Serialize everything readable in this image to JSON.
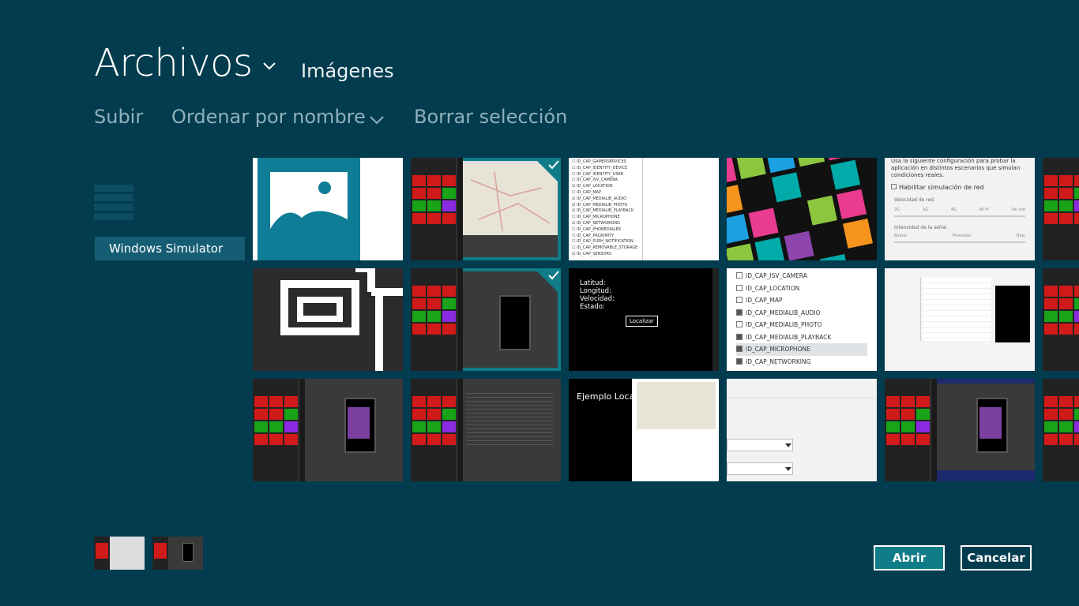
{
  "header": {
    "title": "Archivos",
    "subtitle": "Imágenes"
  },
  "commands": {
    "up": "Subir",
    "sort": "Ordenar por nombre",
    "clear": "Borrar selección"
  },
  "location": "Windows Simulator",
  "tiles": {
    "t14_lines": [
      "Latitud:",
      "Longitud:",
      "Velocidad:",
      "Estado:"
    ],
    "t14_button": "Localizar",
    "t15_caps": [
      "ID_CAP_ISV_CAMERA",
      "ID_CAP_LOCATION",
      "ID_CAP_MAP",
      "ID_CAP_MEDIALIB_AUDIO",
      "ID_CAP_MEDIALIB_PHOTO",
      "ID_CAP_MEDIALIB_PLAYBACK",
      "ID_CAP_MICROPHONE",
      "ID_CAP_NETWORKING"
    ],
    "t05_text1": "Usa la siguiente configuración para probar la aplicación en distintos escenarios que simulan condiciones reales.",
    "t05_check": "Habilitar simulación de red",
    "t05_net_speed": "Velocidad de red",
    "t05_speeds": [
      "2G",
      "3G",
      "4G",
      "Wi-Fi",
      "Sin red"
    ],
    "t05_signal": "Intensidad de la señal",
    "t05_signal_levels": [
      "Bueno",
      "Promedio",
      "Bajo"
    ],
    "t23_title": "Ejemplo Locali"
  },
  "buttons": {
    "open": "Abrir",
    "cancel": "Cancelar"
  },
  "colors": {
    "background": "#033c4e",
    "accent": "#0f7c88"
  }
}
